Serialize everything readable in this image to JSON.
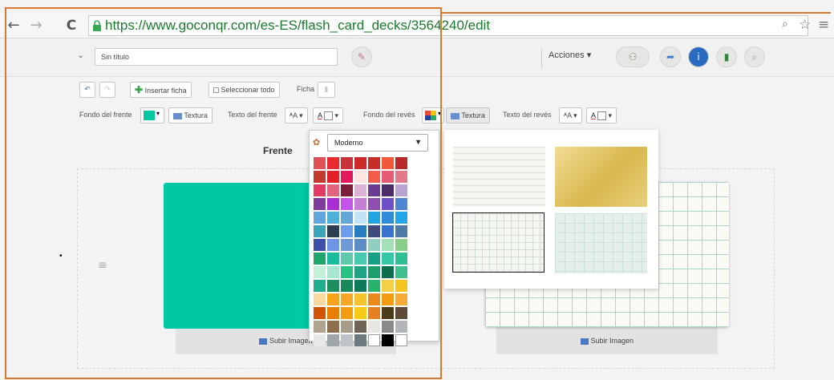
{
  "browser": {
    "url": "https://www.goconqr.com/es-ES/flash_card_decks/3564240/edit",
    "back_icon": "←",
    "forward_icon": "→",
    "reload_icon": "C",
    "zoom_icon": "🔍",
    "star_icon": "☆",
    "menu_icon": "≡"
  },
  "header": {
    "title_value": "Sin título",
    "acciones_label": "Acciones ▾"
  },
  "toolbar": {
    "insert_label": "Insertar ficha",
    "select_all_label": "Seleccionar todo",
    "ficha_label": "Ficha",
    "fondo_frente_label": "Fondo del frente",
    "textura_label": "Textura",
    "texto_frente_label": "Texto del frente",
    "fondo_reves_label": "Fondo del revés",
    "textura_reves_label": "Textura",
    "texto_reves_label": "Texto del revés",
    "font_size_label": "ᴬA",
    "text_color_label": "A"
  },
  "editor": {
    "front_heading": "Frente",
    "front_upload": "Subir Imagen",
    "back_upload": "Subir Imagen",
    "front_color": "#00c8a3"
  },
  "color_picker": {
    "palette_name": "Moderno",
    "colors": [
      "#e14f57",
      "#e72a30",
      "#c93239",
      "#cc2a2a",
      "#c52f28",
      "#f05a3b",
      "#b92b2b",
      "#c33a2e",
      "#e31f27",
      "#e3195d",
      "#fbe6e1",
      "#f55c4a",
      "#e75b74",
      "#e17a8a",
      "#e23c64",
      "#e0647c",
      "#7d1d3c",
      "#d9b2d4",
      "#6c3c93",
      "#4b2d6a",
      "#b7a3d4",
      "#7e3c9b",
      "#a92fd3",
      "#c454e9",
      "#c67dd6",
      "#8f4eaf",
      "#6d4fc5",
      "#4b87d3",
      "#5da7dc",
      "#4fb0d9",
      "#63a7d6",
      "#c1e3f3",
      "#22a6df",
      "#2e8bd8",
      "#23a6e8",
      "#3ca5ba",
      "#2c3e50",
      "#6b9de8",
      "#2a7cc1",
      "#3e4b7c",
      "#3874c9",
      "#4d7ba6",
      "#3d4fa8",
      "#6d95e3",
      "#6e9bd8",
      "#5b8cc6",
      "#8ecfc0",
      "#a3e0b8",
      "#89cf8b",
      "#20a66a",
      "#1abc9c",
      "#5fc9ae",
      "#48c9b0",
      "#16a085",
      "#35c7a5",
      "#2ebf93",
      "#c2f0d8",
      "#a6e6d0",
      "#26c281",
      "#1fa382",
      "#1b9e6b",
      "#0b6e4f",
      "#3fbf8e",
      "#1fae8e",
      "#1e8e5e",
      "#17875c",
      "#0f7a5a",
      "#27b36a",
      "#f3d046",
      "#f4c41f",
      "#f8d9a0",
      "#f7a51d",
      "#f5a623",
      "#f4c430",
      "#e98a1b",
      "#f39c12",
      "#f5ab35",
      "#d35400",
      "#e87e04",
      "#f39c12",
      "#f7ca18",
      "#e67e22",
      "#4b3b1b",
      "#5f4b3a",
      "#b0a491",
      "#8e6e4e",
      "#a79c88",
      "#6f6353",
      "#e8e6e2",
      "#8a8a8a",
      "#b2b6b8",
      "#e8e8e8",
      "#a0a5a8",
      "#bec3c7",
      "#6c7a7d",
      "#ffffff",
      "#000000",
      "#ffffff"
    ]
  },
  "textures": {
    "names": [
      "lined-paper",
      "gold-gradient",
      "grid-dark",
      "grid-mint"
    ]
  }
}
